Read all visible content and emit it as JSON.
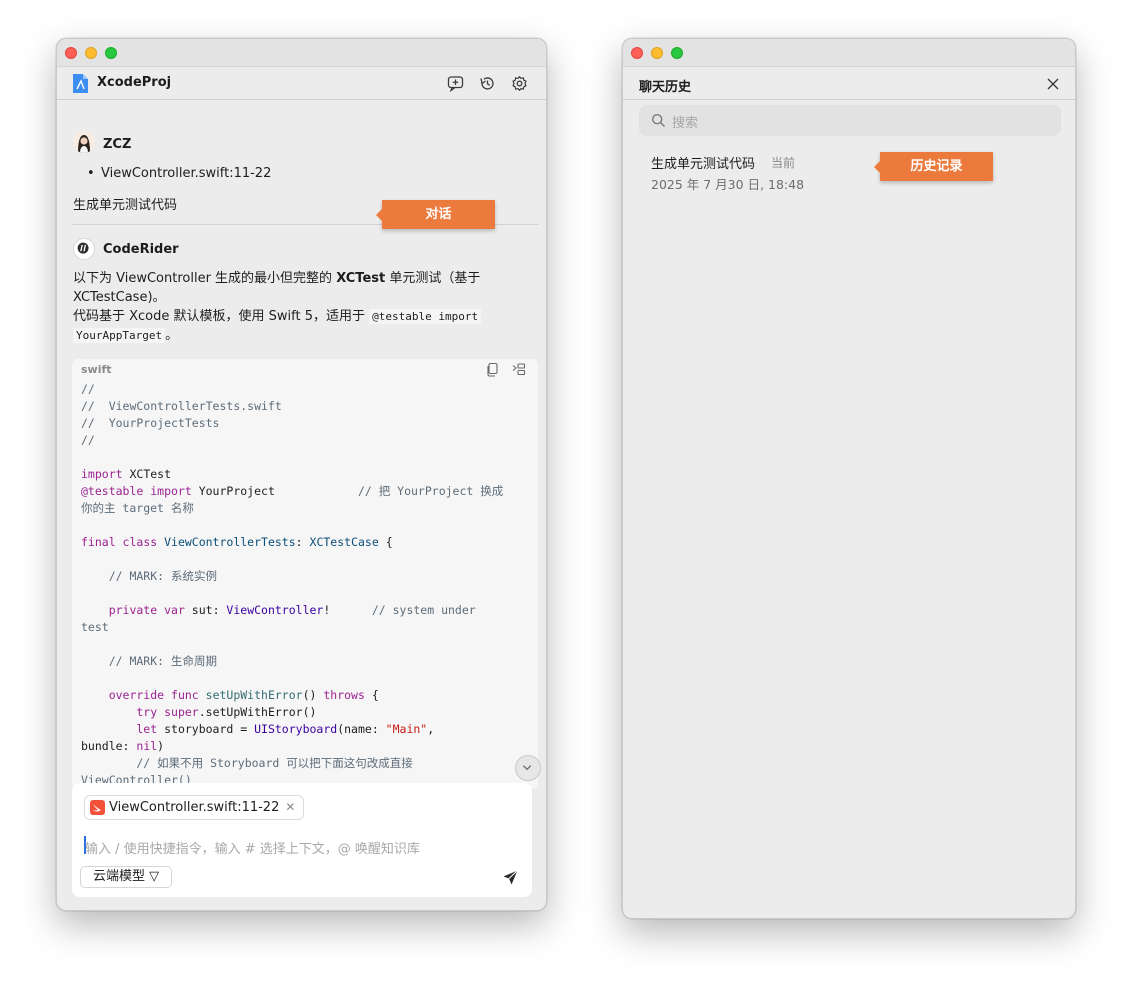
{
  "left_window": {
    "app_title": "XcodeProj",
    "header_icons": [
      "new-chat-icon",
      "history-icon",
      "settings-icon"
    ],
    "user": {
      "name": "ZCZ",
      "context_item": "ViewController.swift:11-22",
      "message": "生成单元测试代码"
    },
    "assistant": {
      "name": "CodeRider",
      "line1_a": "以下为 ViewController 生成的最小但完整的 ",
      "line1_b": "XCTest",
      "line1_c": " 单元测试（基于",
      "line2": "XCTestCase)。",
      "line3_a": "代码基于 Xcode 默认模板，使用 Swift 5，适用于 ",
      "line3_code": "@testable import",
      "line4_code": "YourAppTarget",
      "line4_tail": "。"
    },
    "code_block": {
      "language": "swift",
      "icons": [
        "copy-icon",
        "insert-icon"
      ],
      "lines": {
        "c1": "//",
        "c2": "//  ViewControllerTests.swift",
        "c3": "//  YourProjectTests",
        "c4": "//",
        "import_kw": "import",
        "import_mod": " XCTest",
        "testable_attr": "@testable",
        "testable_kw": " import",
        "testable_mod": " YourProject",
        "testable_cm": "            // 把 YourProject 换成",
        "testable_cm2": "你的主 target 名称",
        "final_kw": "final",
        "class_kw": " class",
        "class_name": " ViewControllerTests",
        "class_colon": ": ",
        "class_super": "XCTestCase",
        "class_brace": " {",
        "mark1": "    // MARK: 系统实例",
        "priv_kw": "    private",
        "var_kw": " var",
        "sut_name": " sut: ",
        "sut_type": "ViewController",
        "sut_bang": "!",
        "sut_cm": "      // system under",
        "sut_cm2": "test",
        "mark2": "    // MARK: 生命周期",
        "override_kw": "    override",
        "func_kw": " func",
        "setup_fn": " setUpWithError",
        "setup_paren": "() ",
        "throws_kw": "throws",
        "setup_brace": " {",
        "try_kw": "        try",
        "super_kw": " super",
        "super_call": ".setUpWithError()",
        "let_kw": "        let",
        "sb_name": " storyboard = ",
        "sb_type": "UIStoryboard",
        "sb_args": "(name: ",
        "sb_str": "\"Main\"",
        "sb_comma": ",",
        "bundle": "bundle: ",
        "nil_kw": "nil",
        "bundle_close": ")",
        "cm_final": "        // 如果不用 Storyboard 可以把下面这句改成直接",
        "cm_final2": "ViewController()"
      }
    },
    "composer": {
      "context_chip": "ViewController.swift:11-22",
      "placeholder": "输入 / 使用快捷指令，输入 # 选择上下文，@ 唤醒知识库",
      "model_button": "云端模型 ▽"
    },
    "callout": "对话"
  },
  "right_window": {
    "title": "聊天历史",
    "search_placeholder": "搜索",
    "history": [
      {
        "title": "生成单元测试代码",
        "badge": "当前",
        "date": "2025 年 7 月30 日, 18:48"
      }
    ],
    "callout": "历史记录"
  },
  "colors": {
    "callout": "#ed7a3d",
    "window_bg": "#ececec",
    "keyword": "#9b2393",
    "string": "#c41a16"
  }
}
